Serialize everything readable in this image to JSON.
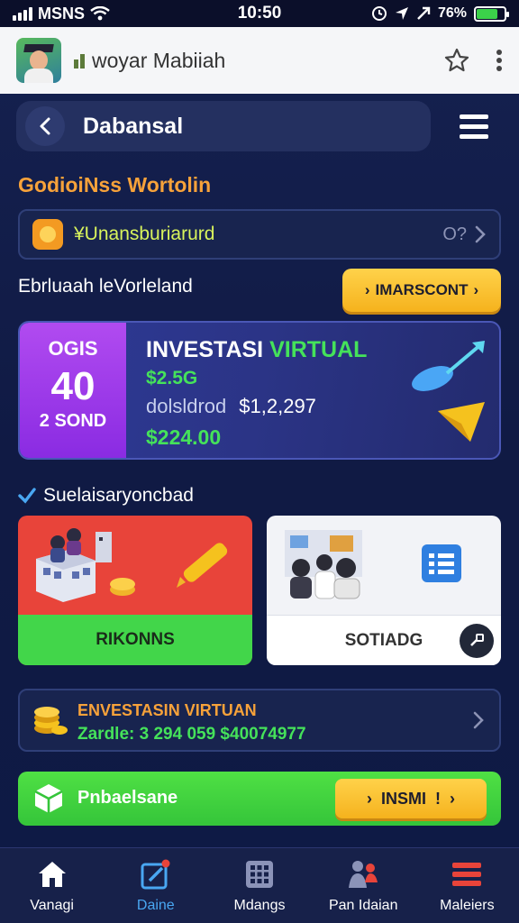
{
  "status_bar": {
    "carrier": "MSNS",
    "time": "10:50",
    "battery": "76%",
    "battery_level": 0.76
  },
  "browser": {
    "site_title": "woyar Mabiiah"
  },
  "header": {
    "title": "Dabansal"
  },
  "section": {
    "title": "GodioiNss Wortolin"
  },
  "info_row": {
    "text": "¥Unansburiarurd",
    "side": "O?"
  },
  "sub": {
    "title": "Ebrluaah leVorleland",
    "button": "IMARSCONT"
  },
  "invest_card": {
    "promo_top": "OGIS",
    "promo_big": "40",
    "promo_bottom": "2 SOND",
    "heading_white": "INVESTASI",
    "heading_green": "VIRTUAL",
    "line1": "$2.5G",
    "line2_label": "dolsldrod",
    "line2_value": "$1,2,297",
    "line3": "$224.00"
  },
  "check": {
    "title": "Suelaisaryoncbad"
  },
  "tiles": [
    {
      "label": "RIKONNS"
    },
    {
      "label": "SOTIADG"
    }
  ],
  "list_card": {
    "title": "ENVESTASIN VIRTUAN",
    "subtitle": "Zardle: 3 294 059 $40074977"
  },
  "green_card": {
    "text": "Pnbaelsane",
    "button": "INSMI"
  },
  "nav": [
    {
      "label": "Vanagi"
    },
    {
      "label": "Daine"
    },
    {
      "label": "Mdangs"
    },
    {
      "label": "Pan Idaian"
    },
    {
      "label": "Maleiers"
    }
  ],
  "colors": {
    "accent_green": "#45e25a",
    "accent_orange": "#f7a23a",
    "accent_yellow": "#f5b21d",
    "accent_purple": "#8a2be2",
    "background": "#101a44"
  }
}
